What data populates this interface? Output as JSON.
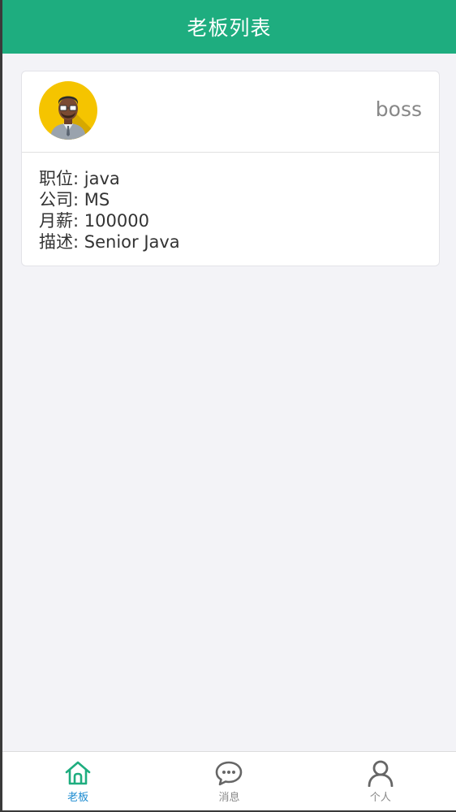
{
  "navbar": {
    "title": "老板列表"
  },
  "card": {
    "extra": "boss",
    "lines": [
      {
        "label": "职位",
        "value": "java"
      },
      {
        "label": "公司",
        "value": "MS"
      },
      {
        "label": "月薪",
        "value": "100000"
      },
      {
        "label": "描述",
        "value": "Senior Java"
      }
    ]
  },
  "tabs": [
    {
      "label": "老板",
      "icon": "home-icon",
      "active": true
    },
    {
      "label": "消息",
      "icon": "message-bubble-icon",
      "active": false
    },
    {
      "label": "个人",
      "icon": "person-icon",
      "active": false
    }
  ],
  "colors": {
    "accent": "#1ead7f",
    "active_tab_label": "#1a8ad0",
    "background": "#f3f3f7",
    "avatar_bg": "#f5c400"
  }
}
